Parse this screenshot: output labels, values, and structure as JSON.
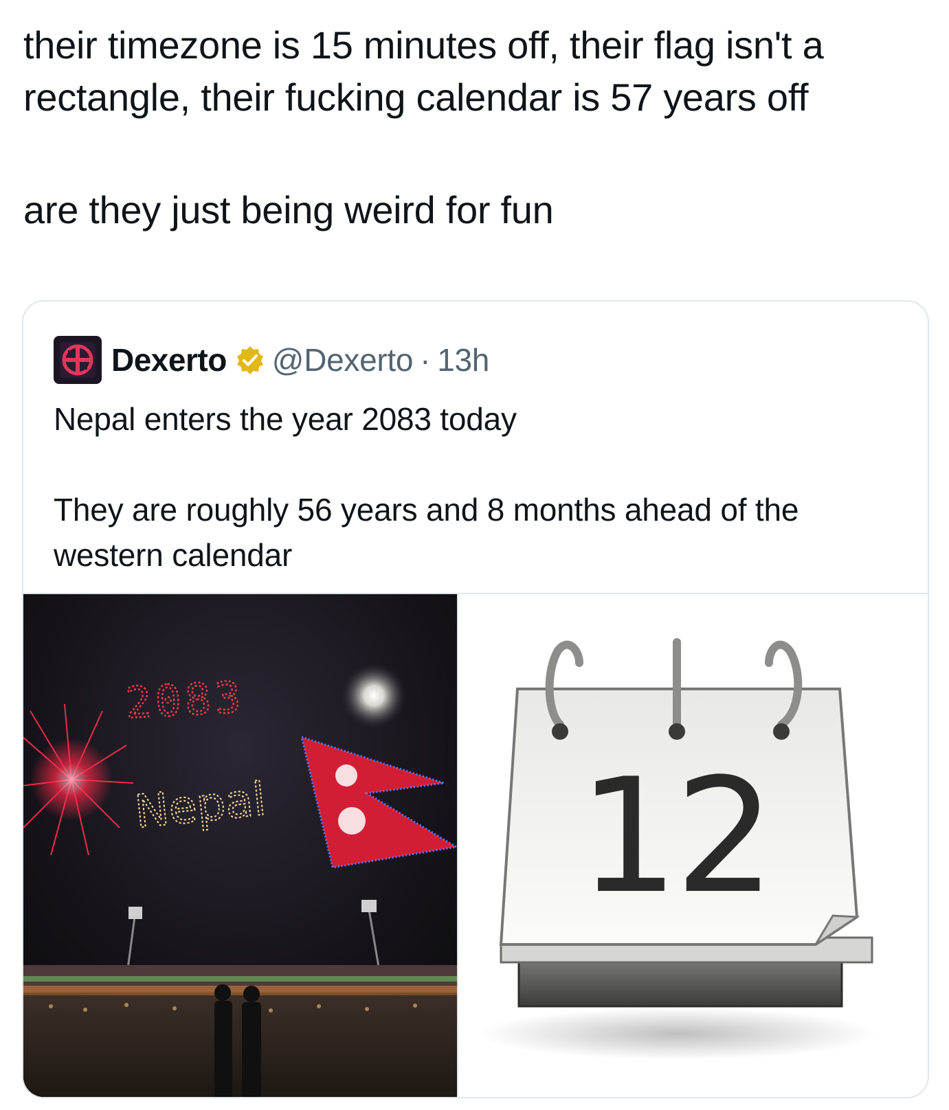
{
  "post": {
    "line1": "their timezone is 15 minutes off, their flag isn't a rectangle, their fucking calendar is 57 years off",
    "line2": "are they just being weird for fun"
  },
  "quoted_post": {
    "display_name": "Dexerto",
    "handle": "@Dexerto",
    "separator": "·",
    "time": "13h",
    "body_line1": "Nepal enters the year 2083 today",
    "body_line2": "They are roughly 56 years and 8 months ahead of the western calendar",
    "verified_badge_color": "#e2b719"
  },
  "media": {
    "photo": {
      "sky_text_year": "2083",
      "sky_text_country": "Nepal"
    },
    "calendar_icon": {
      "day_number": "12"
    }
  },
  "icons": [
    "dexerto-logo-icon",
    "verified-badge-icon",
    "calendar-icon"
  ]
}
